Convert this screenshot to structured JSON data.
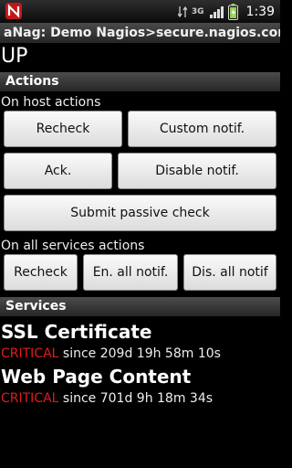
{
  "status_bar": {
    "network": "3G",
    "time": "1:39",
    "icons": [
      "nagios-app-icon",
      "download-arrows-icon",
      "signal-icon",
      "battery-icon"
    ]
  },
  "app_title": "aNag: Demo Nagios>secure.nagios.com",
  "host_state": "UP",
  "actions": {
    "header": "Actions",
    "host_label": "On host actions",
    "recheck": "Recheck",
    "custom_notif": "Custom notif.",
    "ack": "Ack.",
    "disable_notif": "Disable notif.",
    "submit_passive": "Submit passive check",
    "services_label": "On all services actions",
    "svc_recheck": "Recheck",
    "enable_all": "En. all notif.",
    "disable_all": "Dis. all notif"
  },
  "services": {
    "header": "Services",
    "items": [
      {
        "name": "SSL Certificate",
        "state": "CRITICAL",
        "since": " since 209d 19h 58m 10s"
      },
      {
        "name": "Web Page Content",
        "state": "CRITICAL",
        "since": " since 701d 9h 18m 34s"
      }
    ]
  },
  "colors": {
    "critical": "#e21b1b",
    "background": "#000000"
  }
}
